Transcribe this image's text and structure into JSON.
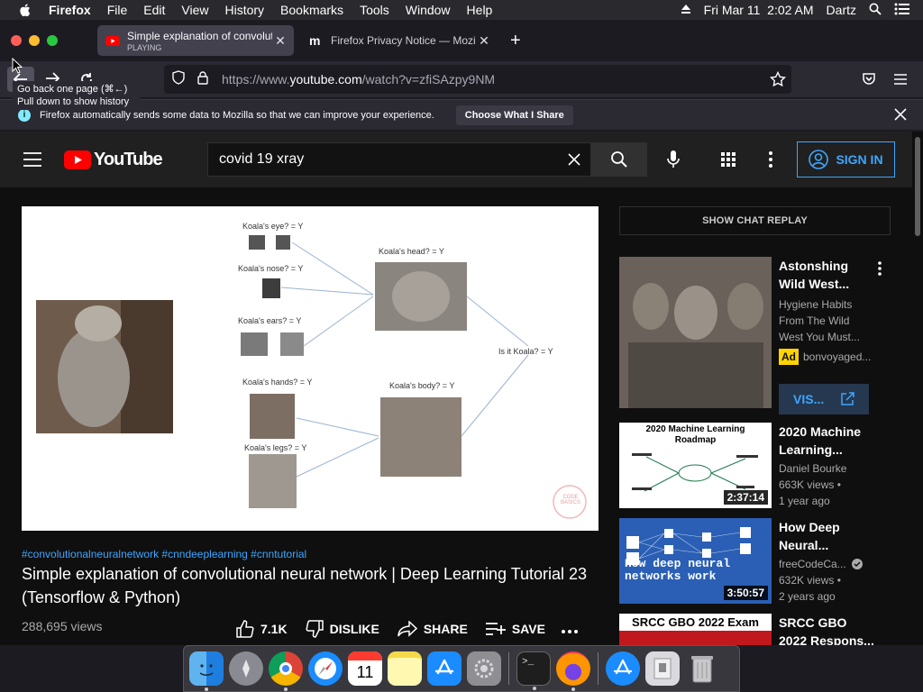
{
  "menubar": {
    "app": "Firefox",
    "items": [
      "File",
      "Edit",
      "View",
      "History",
      "Bookmarks",
      "Tools",
      "Window",
      "Help"
    ],
    "datetime": "Fri Mar 11  2:02 AM",
    "user": "Dartz"
  },
  "tabs": [
    {
      "title": "Simple explanation of convolutio",
      "status": "PLAYING"
    },
    {
      "title": "Firefox Privacy Notice — Mozilla"
    }
  ],
  "navbar": {
    "url_prefix": "https://www.",
    "url_domain": "youtube.com",
    "url_path": "/watch?v=zfiSAzpy9NM",
    "tooltip_line1": "Go back one page (⌘←)",
    "tooltip_line2": "Pull down to show history"
  },
  "notice": {
    "text": "Firefox automatically sends some data to Mozilla so that we can improve your experience.",
    "button": "Choose What I Share"
  },
  "youtube": {
    "logo": "YouTube",
    "search_value": "covid 19 xray",
    "signin": "SIGN IN",
    "hashtags": "#convolutionalneuralnetwork #cnndeeplearning #cnntutorial",
    "title": "Simple explanation of convolutional neural network | Deep Learning Tutorial 23 (Tensorflow & Python)",
    "views": "288,695 views",
    "likes": "7.1K",
    "dislike": "DISLIKE",
    "share": "SHARE",
    "save": "SAVE",
    "chat_replay": "SHOW CHAT REPLAY",
    "video_diagram": {
      "eye": "Koala's eye? = Y",
      "nose": "Koala's nose? = Y",
      "ears": "Koala's ears? = Y",
      "hands": "Koala's hands? = Y",
      "legs": "Koala's legs? = Y",
      "head": "Koala's head? = Y",
      "body": "Koala's body? = Y",
      "is_koala": "Is it Koala? = Y",
      "watermark": "CODE BASICS"
    }
  },
  "recommendations": [
    {
      "title": "Astonshing Wild West...",
      "line1": "Hygiene Habits From The Wild West You Must...",
      "ad": "Ad",
      "channel": "bonvoyaged...",
      "cta": "VIS..."
    },
    {
      "title": "2020 Machine Learning...",
      "channel": "Daniel Bourke",
      "views": "663K views •",
      "age": "1 year ago",
      "duration": "2:37:14",
      "thumb_text": "2020 Machine Learning Roadmap"
    },
    {
      "title": "How Deep Neural...",
      "channel": "freeCodeCa...",
      "views": "632K views •",
      "age": "2 years ago",
      "duration": "3:50:57",
      "thumb_text": "How deep neural networks work"
    },
    {
      "title": "SRCC GBO 2022 Respons...",
      "thumb_text": "SRCC GBO 2022 Exam"
    }
  ],
  "colors": {
    "yt_red": "#ff0000",
    "link_blue": "#3ea6ff",
    "ad_yellow": "#ffd400"
  }
}
